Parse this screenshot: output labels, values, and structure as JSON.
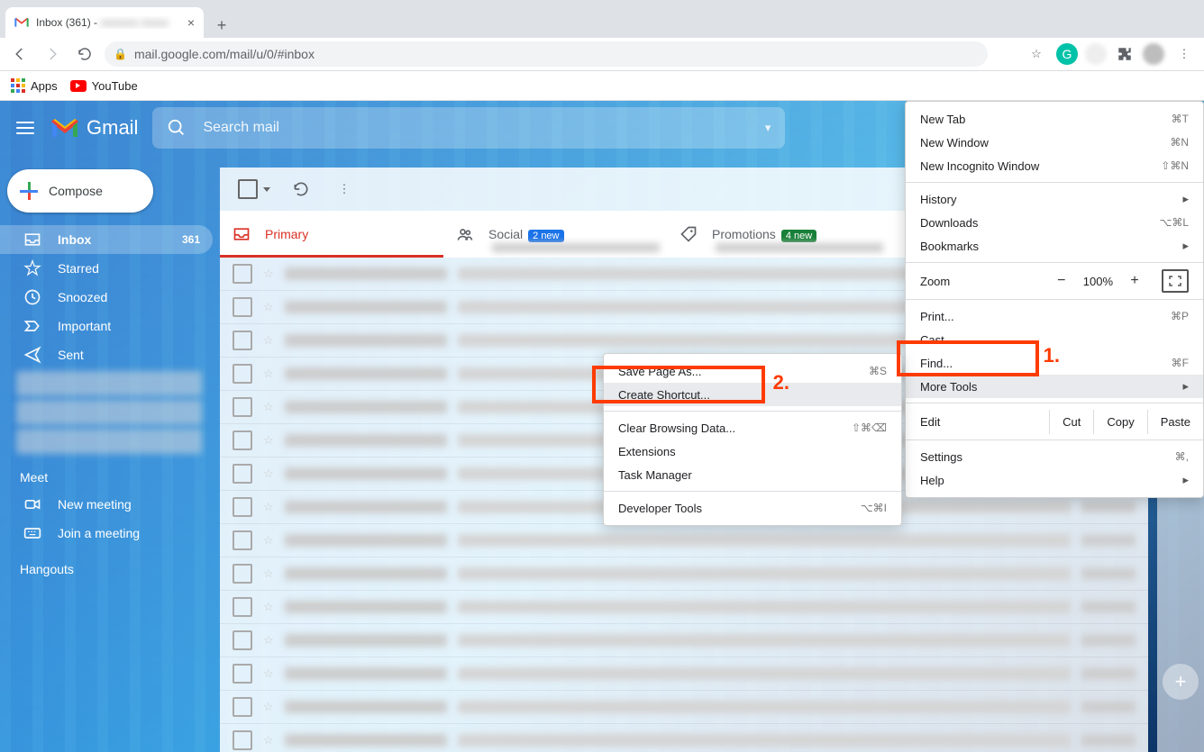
{
  "browser": {
    "tab_title": "Inbox (361) -",
    "new_tab_tooltip": "+",
    "url": "mail.google.com/mail/u/0/#inbox",
    "bookmarks": [
      {
        "label": "Apps"
      },
      {
        "label": "YouTube"
      }
    ]
  },
  "gmail": {
    "brand": "Gmail",
    "search_placeholder": "Search mail",
    "compose": "Compose",
    "nav": [
      {
        "id": "inbox",
        "label": "Inbox",
        "count": "361",
        "active": true,
        "icon": "inbox"
      },
      {
        "id": "starred",
        "label": "Starred",
        "icon": "star"
      },
      {
        "id": "snoozed",
        "label": "Snoozed",
        "icon": "clock"
      },
      {
        "id": "important",
        "label": "Important",
        "icon": "important"
      },
      {
        "id": "sent",
        "label": "Sent",
        "icon": "sent"
      }
    ],
    "meet_header": "Meet",
    "meet_items": [
      {
        "label": "New meeting",
        "icon": "video"
      },
      {
        "label": "Join a meeting",
        "icon": "keyboard"
      }
    ],
    "hangouts_header": "Hangouts",
    "tabs": [
      {
        "id": "primary",
        "label": "Primary",
        "active": true
      },
      {
        "id": "social",
        "label": "Social",
        "badge": "2 new",
        "badge_color": "blue"
      },
      {
        "id": "promotions",
        "label": "Promotions",
        "badge": "4 new",
        "badge_color": "green"
      }
    ],
    "rows": [
      1,
      2,
      3,
      4,
      5,
      6,
      7,
      8,
      9,
      10,
      11,
      12,
      13,
      14,
      15
    ]
  },
  "chrome_menu": {
    "items_top": [
      {
        "label": "New Tab",
        "shortcut": "⌘T"
      },
      {
        "label": "New Window",
        "shortcut": "⌘N"
      },
      {
        "label": "New Incognito Window",
        "shortcut": "⇧⌘N"
      }
    ],
    "items_mid": [
      {
        "label": "History",
        "arrow": true
      },
      {
        "label": "Downloads",
        "shortcut": "⌥⌘L"
      },
      {
        "label": "Bookmarks",
        "arrow": true
      }
    ],
    "zoom_label": "Zoom",
    "zoom_value": "100%",
    "items_mid2": [
      {
        "label": "Print...",
        "shortcut": "⌘P"
      },
      {
        "label": "Cast..."
      },
      {
        "label": "Find...",
        "shortcut": "⌘F"
      },
      {
        "label": "More Tools",
        "arrow": true,
        "highlight": true,
        "callout": "1."
      }
    ],
    "edit_label": "Edit",
    "edit_buttons": [
      "Cut",
      "Copy",
      "Paste"
    ],
    "items_bottom": [
      {
        "label": "Settings",
        "shortcut": "⌘,"
      },
      {
        "label": "Help",
        "arrow": true
      }
    ]
  },
  "submenu": {
    "items": [
      {
        "label": "Save Page As...",
        "shortcut": "⌘S"
      },
      {
        "label": "Create Shortcut...",
        "highlight": true,
        "callout": "2."
      }
    ],
    "items2": [
      {
        "label": "Clear Browsing Data...",
        "shortcut": "⇧⌘⌫"
      },
      {
        "label": "Extensions"
      },
      {
        "label": "Task Manager"
      }
    ],
    "items3": [
      {
        "label": "Developer Tools",
        "shortcut": "⌥⌘I"
      }
    ]
  },
  "callouts": {
    "one": "1.",
    "two": "2."
  }
}
